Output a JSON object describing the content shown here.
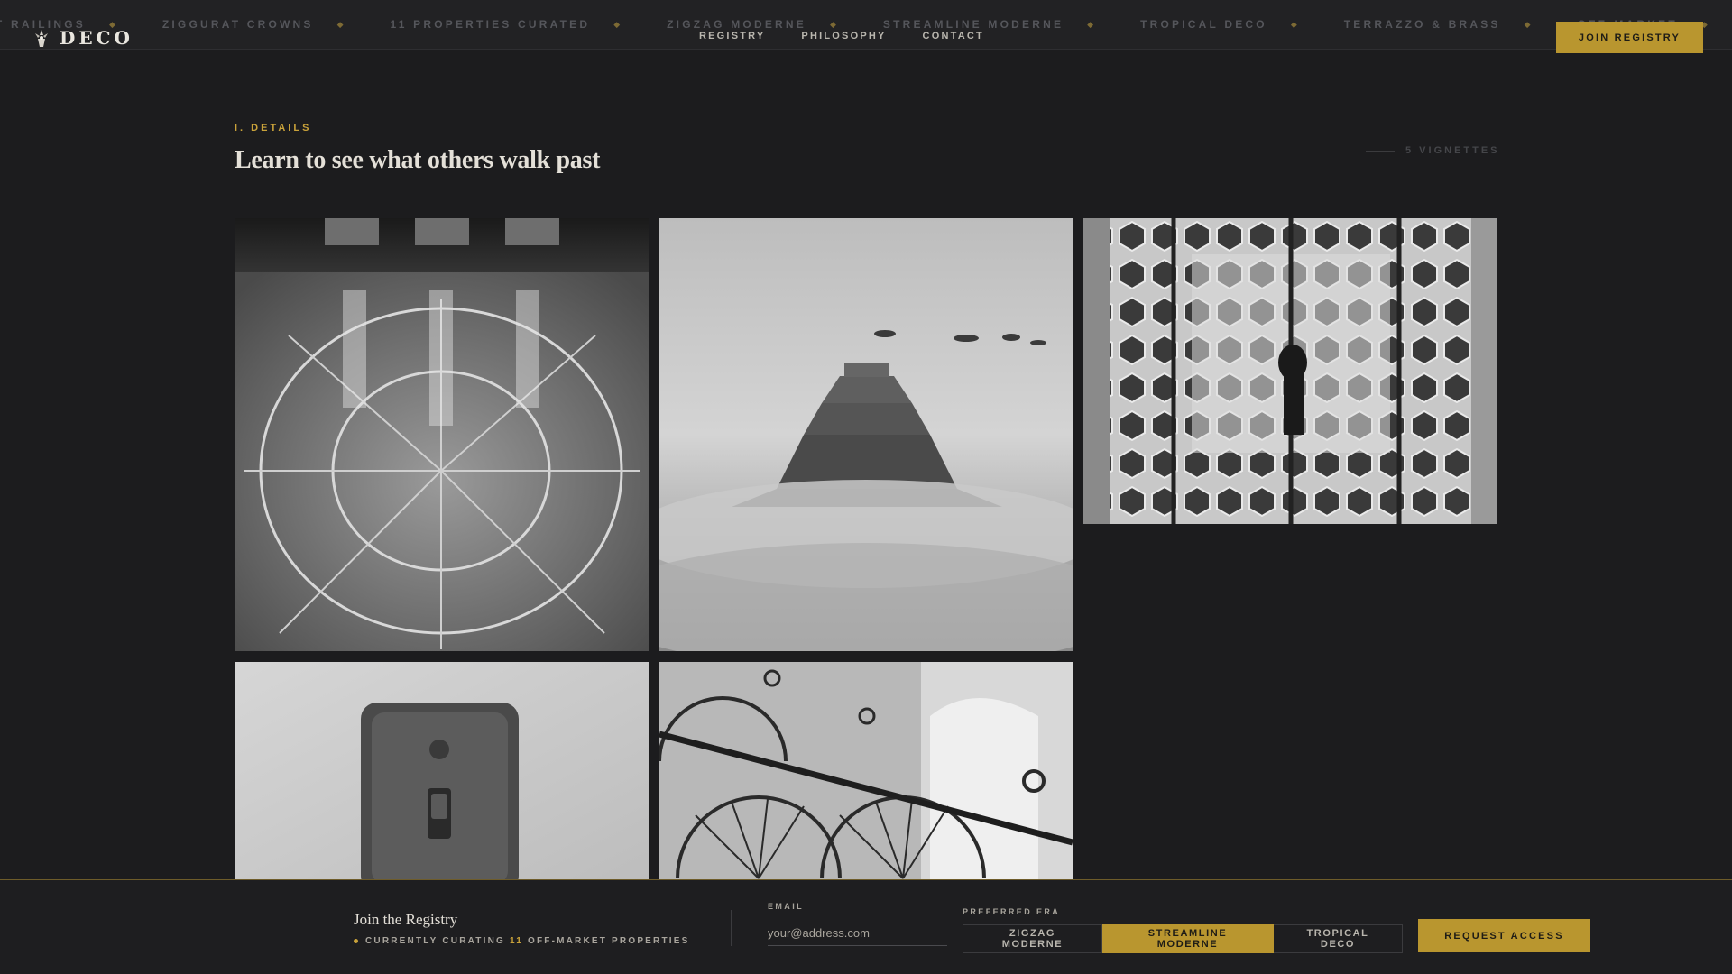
{
  "header": {
    "marquee": [
      "CAST RAILINGS",
      "ZIGGURAT CROWNS",
      "11 PROPERTIES CURATED",
      "ZIGZAG MODERNE",
      "STREAMLINE MODERNE",
      "TROPICAL DECO",
      "TERRAZZO & BRASS",
      "OFF-MARKET"
    ],
    "marquee_separator": "◆",
    "logo": {
      "text": "DECO",
      "icon": "sunburst-logo-icon"
    },
    "nav": [
      "REGISTRY",
      "PHILOSOPHY",
      "CONTACT"
    ],
    "cta": "JOIN REGISTRY"
  },
  "section": {
    "label": "I. DETAILS",
    "title": "Learn to see what others walk past",
    "count": "5 VIGNETTES"
  },
  "gallery": [
    {
      "subject": "terrazzo-floor"
    },
    {
      "subject": "ziggurat-in-fog"
    },
    {
      "subject": "hexagon-mirrored-lobby"
    },
    {
      "subject": "bakelite-light-switch"
    },
    {
      "subject": "fan-pattern-stair-railing"
    }
  ],
  "footer": {
    "title": "Join the Registry",
    "sub_prefix": "CURRENTLY CURATING",
    "sub_count": "11",
    "sub_suffix": "OFF-MARKET PROPERTIES",
    "email_label": "EMAIL",
    "email_placeholder": "your@address.com",
    "era_label": "PREFERRED ERA",
    "era_options": [
      "ZIGZAG MODERNE",
      "STREAMLINE MODERNE",
      "TROPICAL DECO"
    ],
    "era_selected": "STREAMLINE MODERNE",
    "cta": "REQUEST ACCESS"
  },
  "colors": {
    "background": "#1c1c1e",
    "accent_gold": "#b9962f",
    "text_light": "#e4e0d8",
    "text_muted": "#a9a59d"
  }
}
